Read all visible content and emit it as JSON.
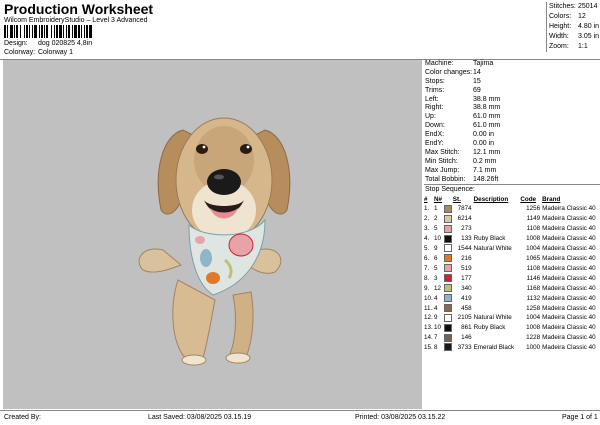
{
  "header": {
    "title": "Production Worksheet",
    "subtitle": "Wilcom EmbroideryStudio – Level 3 Advanced",
    "design_label": "Design:",
    "design_value": "dog 020825 4,8in",
    "colorway_label": "Colorway:",
    "colorway_value": "Colorway 1"
  },
  "stats": [
    {
      "label": "Stitches:",
      "value": "25014"
    },
    {
      "label": "Colors:",
      "value": "12"
    },
    {
      "label": "Height:",
      "value": "4.80 in"
    },
    {
      "label": "Width:",
      "value": "3.05 in"
    },
    {
      "label": "Zoom:",
      "value": "1:1"
    }
  ],
  "params": [
    {
      "label": "Machine:",
      "value": "Tajima"
    },
    {
      "label": "Color changes:",
      "value": "14"
    },
    {
      "label": "Stops:",
      "value": "15"
    },
    {
      "label": "Trims:",
      "value": "69"
    },
    {
      "label": "Left:",
      "value": "38.8 mm"
    },
    {
      "label": "Right:",
      "value": "38.8 mm"
    },
    {
      "label": "Up:",
      "value": "61.0 mm"
    },
    {
      "label": "Down:",
      "value": "61.0 mm"
    },
    {
      "label": "EndX:",
      "value": "0.00 in"
    },
    {
      "label": "EndY:",
      "value": "0.00 in"
    },
    {
      "label": "Max Stitch:",
      "value": "12.1 mm"
    },
    {
      "label": "Min Stitch:",
      "value": "0.2 mm"
    },
    {
      "label": "Max Jump:",
      "value": "7.1 mm"
    },
    {
      "label": "Total Bobbin:",
      "value": "148.26ft"
    }
  ],
  "sequence": {
    "title": "Stop Sequence:",
    "headers": [
      "#",
      "N#",
      "St.",
      "Description",
      "Code",
      "Brand"
    ],
    "rows": [
      {
        "num": "1.",
        "n": "1",
        "color": "#a58a64",
        "st": "7874",
        "desc": "",
        "code": "1256",
        "brand": "Madeira Classic 40"
      },
      {
        "num": "2.",
        "n": "2",
        "color": "#d7c7a8",
        "st": "6214",
        "desc": "",
        "code": "1149",
        "brand": "Madeira Classic 40"
      },
      {
        "num": "3.",
        "n": "5",
        "color": "#e8a3a8",
        "st": "273",
        "desc": "",
        "code": "1108",
        "brand": "Madeira Classic 40"
      },
      {
        "num": "4.",
        "n": "10",
        "color": "#101010",
        "st": "133",
        "desc": "Ruby Black",
        "code": "1008",
        "brand": "Madeira Classic 40"
      },
      {
        "num": "5.",
        "n": "9",
        "color": "#ffffff",
        "st": "1544",
        "desc": "Natural White",
        "code": "1004",
        "brand": "Madeira Classic 40"
      },
      {
        "num": "6.",
        "n": "6",
        "color": "#e07a2a",
        "st": "216",
        "desc": "",
        "code": "1065",
        "brand": "Madeira Classic 40"
      },
      {
        "num": "7.",
        "n": "5",
        "color": "#e8a3a8",
        "st": "519",
        "desc": "",
        "code": "1108",
        "brand": "Madeira Classic 40"
      },
      {
        "num": "8.",
        "n": "3",
        "color": "#c8243c",
        "st": "177",
        "desc": "",
        "code": "1146",
        "brand": "Madeira Classic 40"
      },
      {
        "num": "9.",
        "n": "12",
        "color": "#b8c27a",
        "st": "340",
        "desc": "",
        "code": "1168",
        "brand": "Madeira Classic 40"
      },
      {
        "num": "10.",
        "n": "4",
        "color": "#8fb6c8",
        "st": "419",
        "desc": "",
        "code": "1132",
        "brand": "Madeira Classic 40"
      },
      {
        "num": "11.",
        "n": "4",
        "color": "#8a6a4e",
        "st": "458",
        "desc": "",
        "code": "1258",
        "brand": "Madeira Classic 40"
      },
      {
        "num": "12.",
        "n": "9",
        "color": "#ffffff",
        "st": "2105",
        "desc": "Natural White",
        "code": "1004",
        "brand": "Madeira Classic 40"
      },
      {
        "num": "13.",
        "n": "10",
        "color": "#101010",
        "st": "861",
        "desc": "Ruby Black",
        "code": "1008",
        "brand": "Madeira Classic 40"
      },
      {
        "num": "14.",
        "n": "7",
        "color": "#6e6458",
        "st": "146",
        "desc": "",
        "code": "1228",
        "brand": "Madeira Classic 40"
      },
      {
        "num": "15.",
        "n": "8",
        "color": "#1a1a1a",
        "st": "3733",
        "desc": "Emerald Black",
        "code": "1000",
        "brand": "Madeira Classic 40"
      }
    ]
  },
  "footer": {
    "created_by": "Created By:",
    "last_saved": "Last Saved: 03/08/2025 03.15.19",
    "printed": "Printed: 03/08/2025 03.15.22",
    "page": "Page 1 of 1"
  },
  "colors": {
    "canvas_bg": "#c0c0c0",
    "fur_main": "#c9a57a",
    "fur_light": "#e8dcc2",
    "bandana": "#dfe6e2",
    "nose": "#1a1a1a",
    "tongue": "#e88c94"
  }
}
